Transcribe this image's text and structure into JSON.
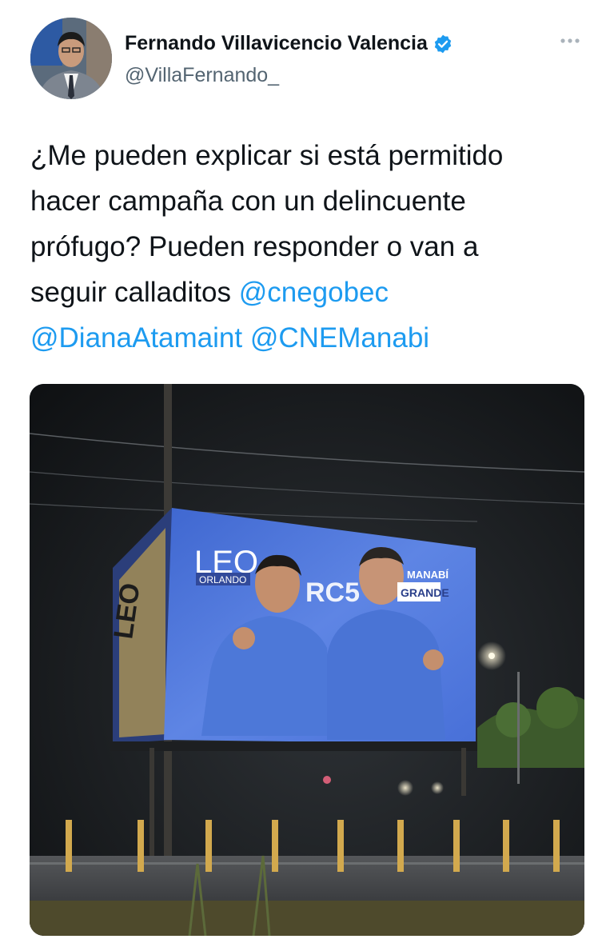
{
  "author": {
    "name": "Fernando Villavicencio Valencia",
    "handle": "@VillaFernando_",
    "verified": true,
    "avatar_icon": "profile-photo"
  },
  "tweet": {
    "line1": "¿Me pueden explicar si está permitido",
    "line2": "hacer campaña con un delincuente",
    "line3": "prófugo? Pueden responder o van a",
    "line4_text": "seguir calladitos ",
    "mention1": "@cnegobec",
    "mention2": "@DianaAtamaint",
    "mention3": "@CNEManabi"
  },
  "media": {
    "billboard": {
      "leo": "LEO",
      "orlando": "ORLANDO",
      "number": "RC5",
      "manabi": "MANABÍ",
      "grande": "GRANDE",
      "side_text": "LEO"
    }
  },
  "colors": {
    "accent": "#1d9bf0",
    "verified": "#1d9bf0",
    "handle": "#536471",
    "billboard_blue": "#4a6fd4"
  }
}
